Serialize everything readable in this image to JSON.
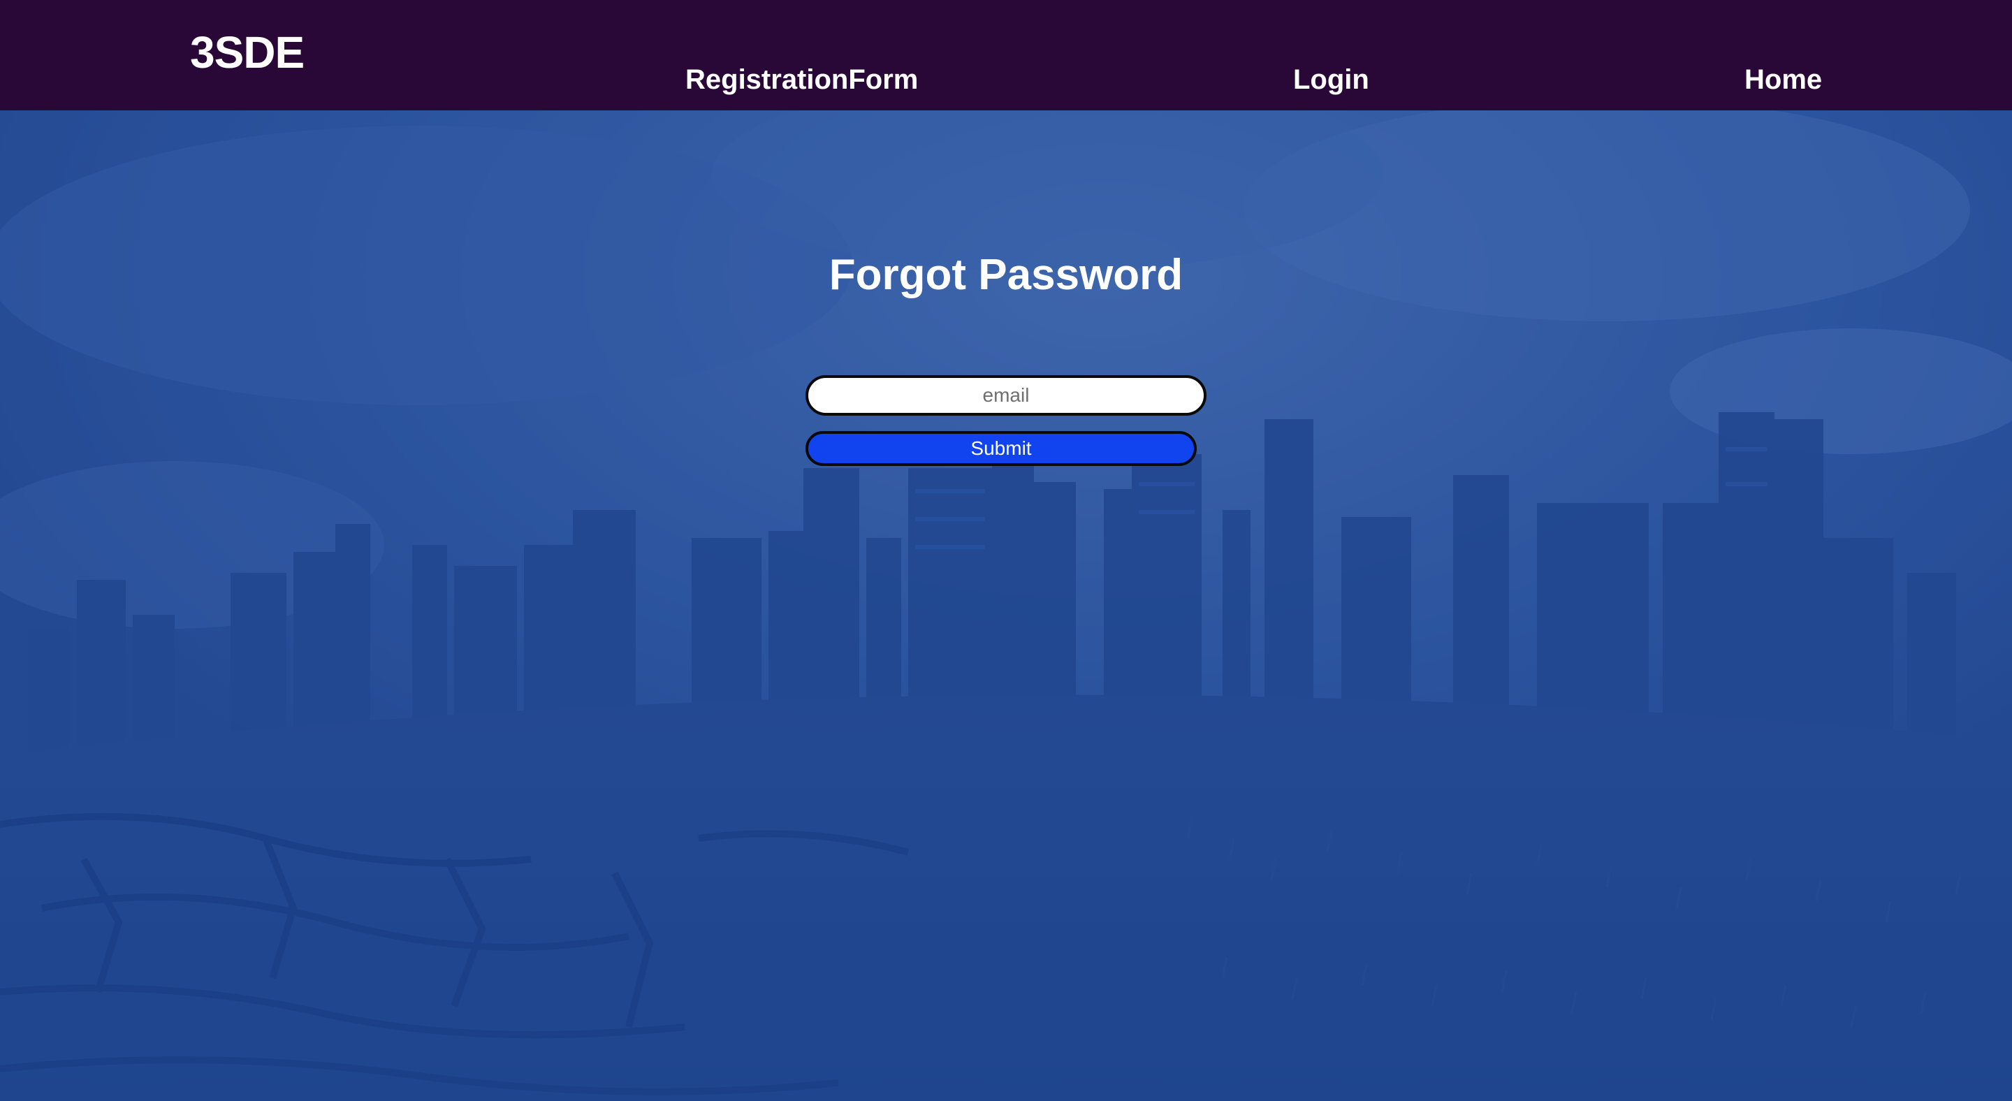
{
  "navbar": {
    "brand": "3SDE",
    "links": [
      {
        "label": "RegistrationForm"
      },
      {
        "label": "Login"
      },
      {
        "label": "Home"
      }
    ]
  },
  "form": {
    "title": "Forgot Password",
    "email_placeholder": "email",
    "email_value": "",
    "submit_label": "Submit"
  },
  "colors": {
    "navbar_bg": "#290838",
    "overlay_blue": "#2c5299",
    "submit_bg": "#1144ee",
    "text": "#ffffff"
  }
}
